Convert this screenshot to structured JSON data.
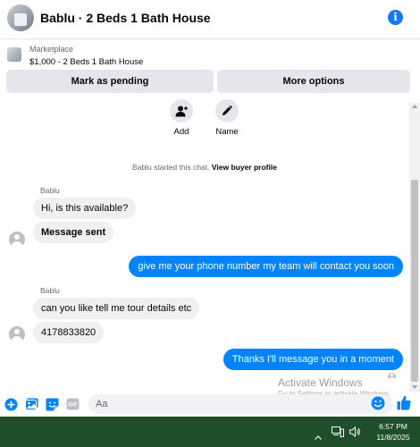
{
  "header": {
    "title": "Bablu · 2 Beds 1 Bath House",
    "info_glyph": "i"
  },
  "marketplace": {
    "label": "Marketplace",
    "listing": "$1,000 - 2 Beds 1 Bath House",
    "mark_pending_label": "Mark as pending",
    "more_options_label": "More options"
  },
  "actions": [
    {
      "icon": "add-person-icon",
      "label": "Add"
    },
    {
      "icon": "pencil-icon",
      "label": "Name"
    }
  ],
  "system": {
    "started_text": "Bablu started this chat.",
    "view_profile_link": "View buyer profile"
  },
  "messages": [
    {
      "from": "Bablu",
      "sender_label": "Bablu",
      "text": "Hi, is this available?"
    },
    {
      "from": "Bablu",
      "text": "Message sent",
      "bold": true
    },
    {
      "from": "me",
      "text": "give me your phone number my team will contact you soon"
    },
    {
      "from": "Bablu",
      "sender_label": "Bablu",
      "text": "can you like tell me tour details etc"
    },
    {
      "from": "Bablu",
      "text": "4178833820"
    },
    {
      "from": "me",
      "text": "Thanks I'll message you in a moment"
    }
  ],
  "composer": {
    "placeholder": "Aa",
    "icons": [
      "plus-icon",
      "photo-icon",
      "sticker-icon",
      "gif-icon",
      "emoji-icon",
      "like-icon"
    ],
    "gif_text": "GIF"
  },
  "watermark": {
    "line1": "Activate Windows",
    "line2": "Go to Settings to activate Windows."
  },
  "taskbar": {
    "time": "6:57 PM",
    "date": "11/8/2025"
  },
  "colors": {
    "accent": "#0084ff",
    "info": "#1877f2",
    "incoming_bubble": "#f0f0f0",
    "button_bg": "#e4e6eb",
    "taskbar": "#1f4e2a"
  }
}
